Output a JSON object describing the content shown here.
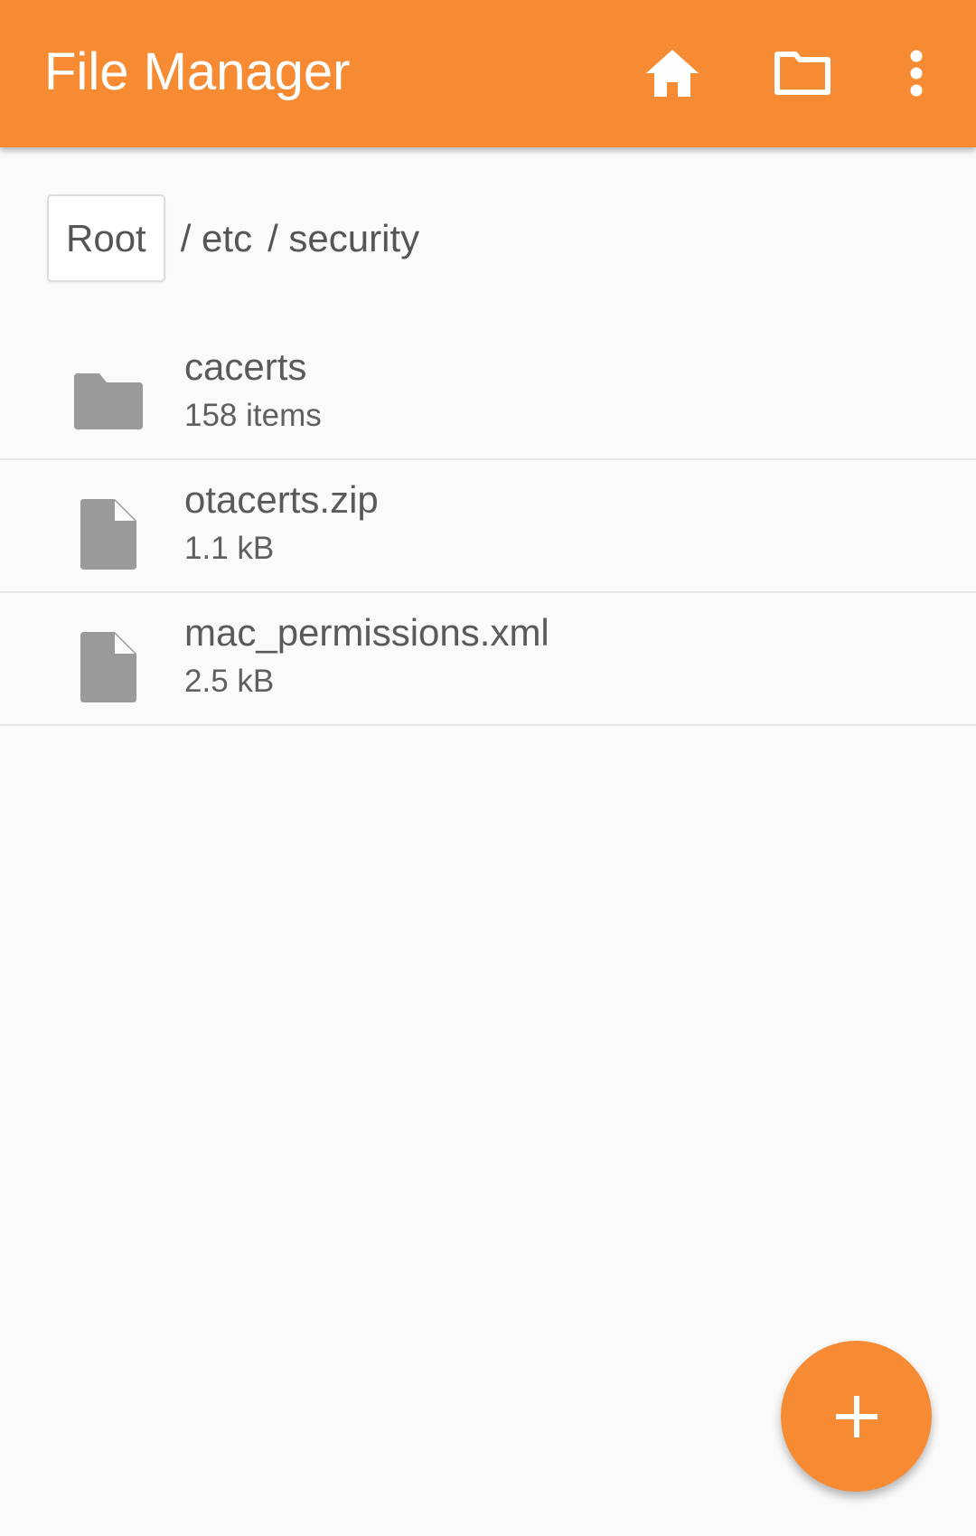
{
  "app": {
    "title": "File Manager",
    "accent_color": "#f68b33",
    "toolbar_icons": [
      "home-icon",
      "folder-icon",
      "more-vert-icon"
    ]
  },
  "breadcrumb": {
    "root_label": "Root",
    "segments": [
      {
        "label": "/ etc"
      },
      {
        "label": "/ security"
      }
    ]
  },
  "files": [
    {
      "name": "cacerts",
      "meta": "158 items",
      "icon": "folder-icon"
    },
    {
      "name": "otacerts.zip",
      "meta": "1.1 kB",
      "icon": "file-icon"
    },
    {
      "name": "mac_permissions.xml",
      "meta": "2.5 kB",
      "icon": "file-icon"
    }
  ],
  "fab": {
    "icon": "plus-icon"
  }
}
